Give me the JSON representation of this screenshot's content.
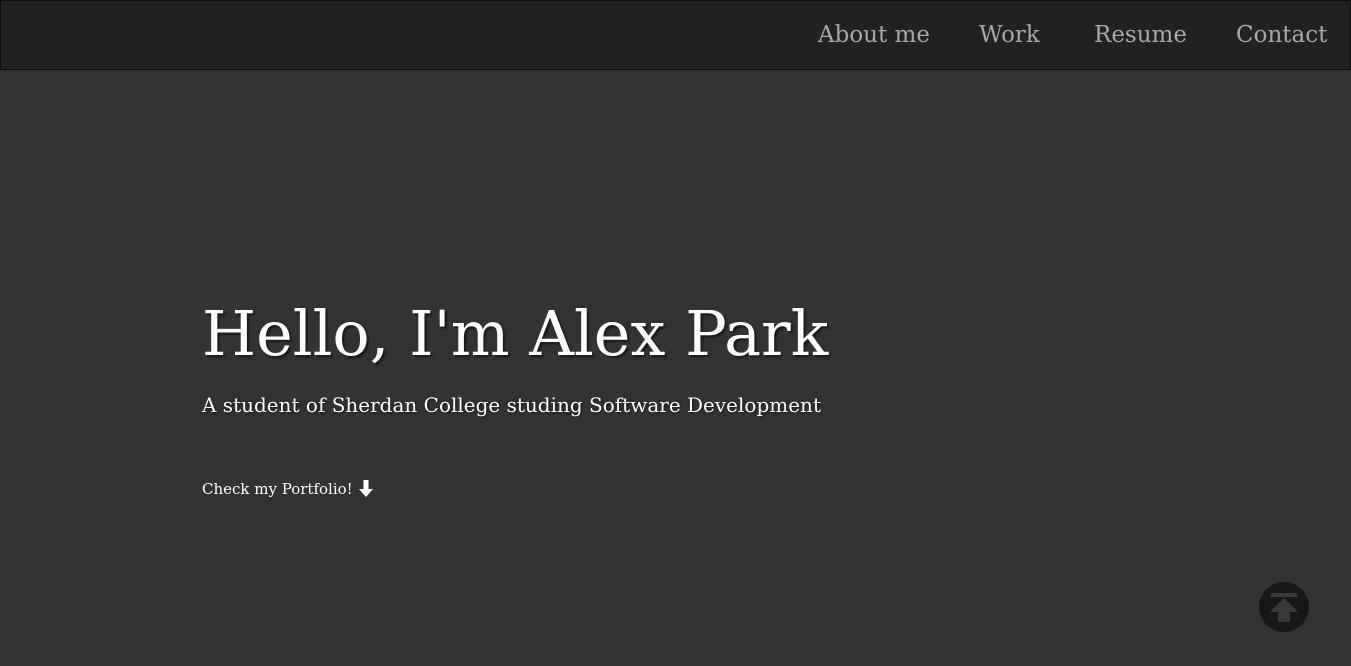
{
  "nav": {
    "items": [
      {
        "label": "About me"
      },
      {
        "label": "Work"
      },
      {
        "label": "Resume"
      },
      {
        "label": "Contact"
      }
    ]
  },
  "hero": {
    "title": "Hello, I'm Alex Park",
    "subtitle": "A student of Sherdan College studing Software Development",
    "cta_label": "Check my Portfolio!",
    "cta_icon": "arrow-down-icon"
  },
  "back_to_top": {
    "icon": "arrow-up-icon"
  },
  "colors": {
    "background": "#333333",
    "navbar": "#222222",
    "nav_text": "#a8a8a8",
    "hero_text": "#ffffff",
    "back_to_top": "#171717"
  }
}
